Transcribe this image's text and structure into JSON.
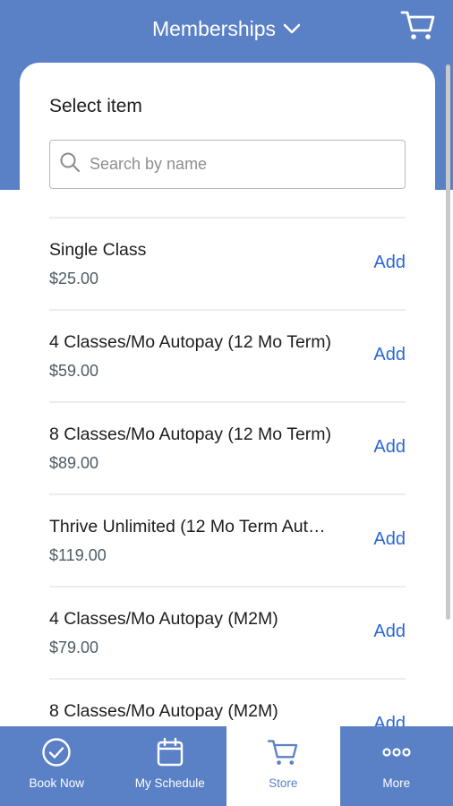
{
  "header": {
    "title": "Memberships"
  },
  "card": {
    "title": "Select item",
    "search": {
      "placeholder": "Search by name",
      "value": ""
    }
  },
  "items": [
    {
      "name": "Single Class",
      "price": "$25.00",
      "action": "Add"
    },
    {
      "name": "4 Classes/Mo Autopay (12 Mo Term)",
      "price": "$59.00",
      "action": "Add"
    },
    {
      "name": "8 Classes/Mo Autopay (12 Mo Term)",
      "price": "$89.00",
      "action": "Add"
    },
    {
      "name": "Thrive Unlimited (12 Mo Term Aut…",
      "price": "$119.00",
      "action": "Add"
    },
    {
      "name": "4 Classes/Mo Autopay (M2M)",
      "price": "$79.00",
      "action": "Add"
    },
    {
      "name": "8 Classes/Mo Autopay (M2M)",
      "price": "",
      "action": "Add"
    }
  ],
  "nav": [
    {
      "label": "Book Now",
      "icon": "check-circle-icon",
      "active": false
    },
    {
      "label": "My Schedule",
      "icon": "calendar-icon",
      "active": false
    },
    {
      "label": "Store",
      "icon": "cart-icon",
      "active": true
    },
    {
      "label": "More",
      "icon": "more-dots-icon",
      "active": false
    }
  ],
  "colors": {
    "primary": "#5a80c5",
    "link": "#2b66d9",
    "price": "#4d5b66",
    "text": "#1d1d1d"
  }
}
